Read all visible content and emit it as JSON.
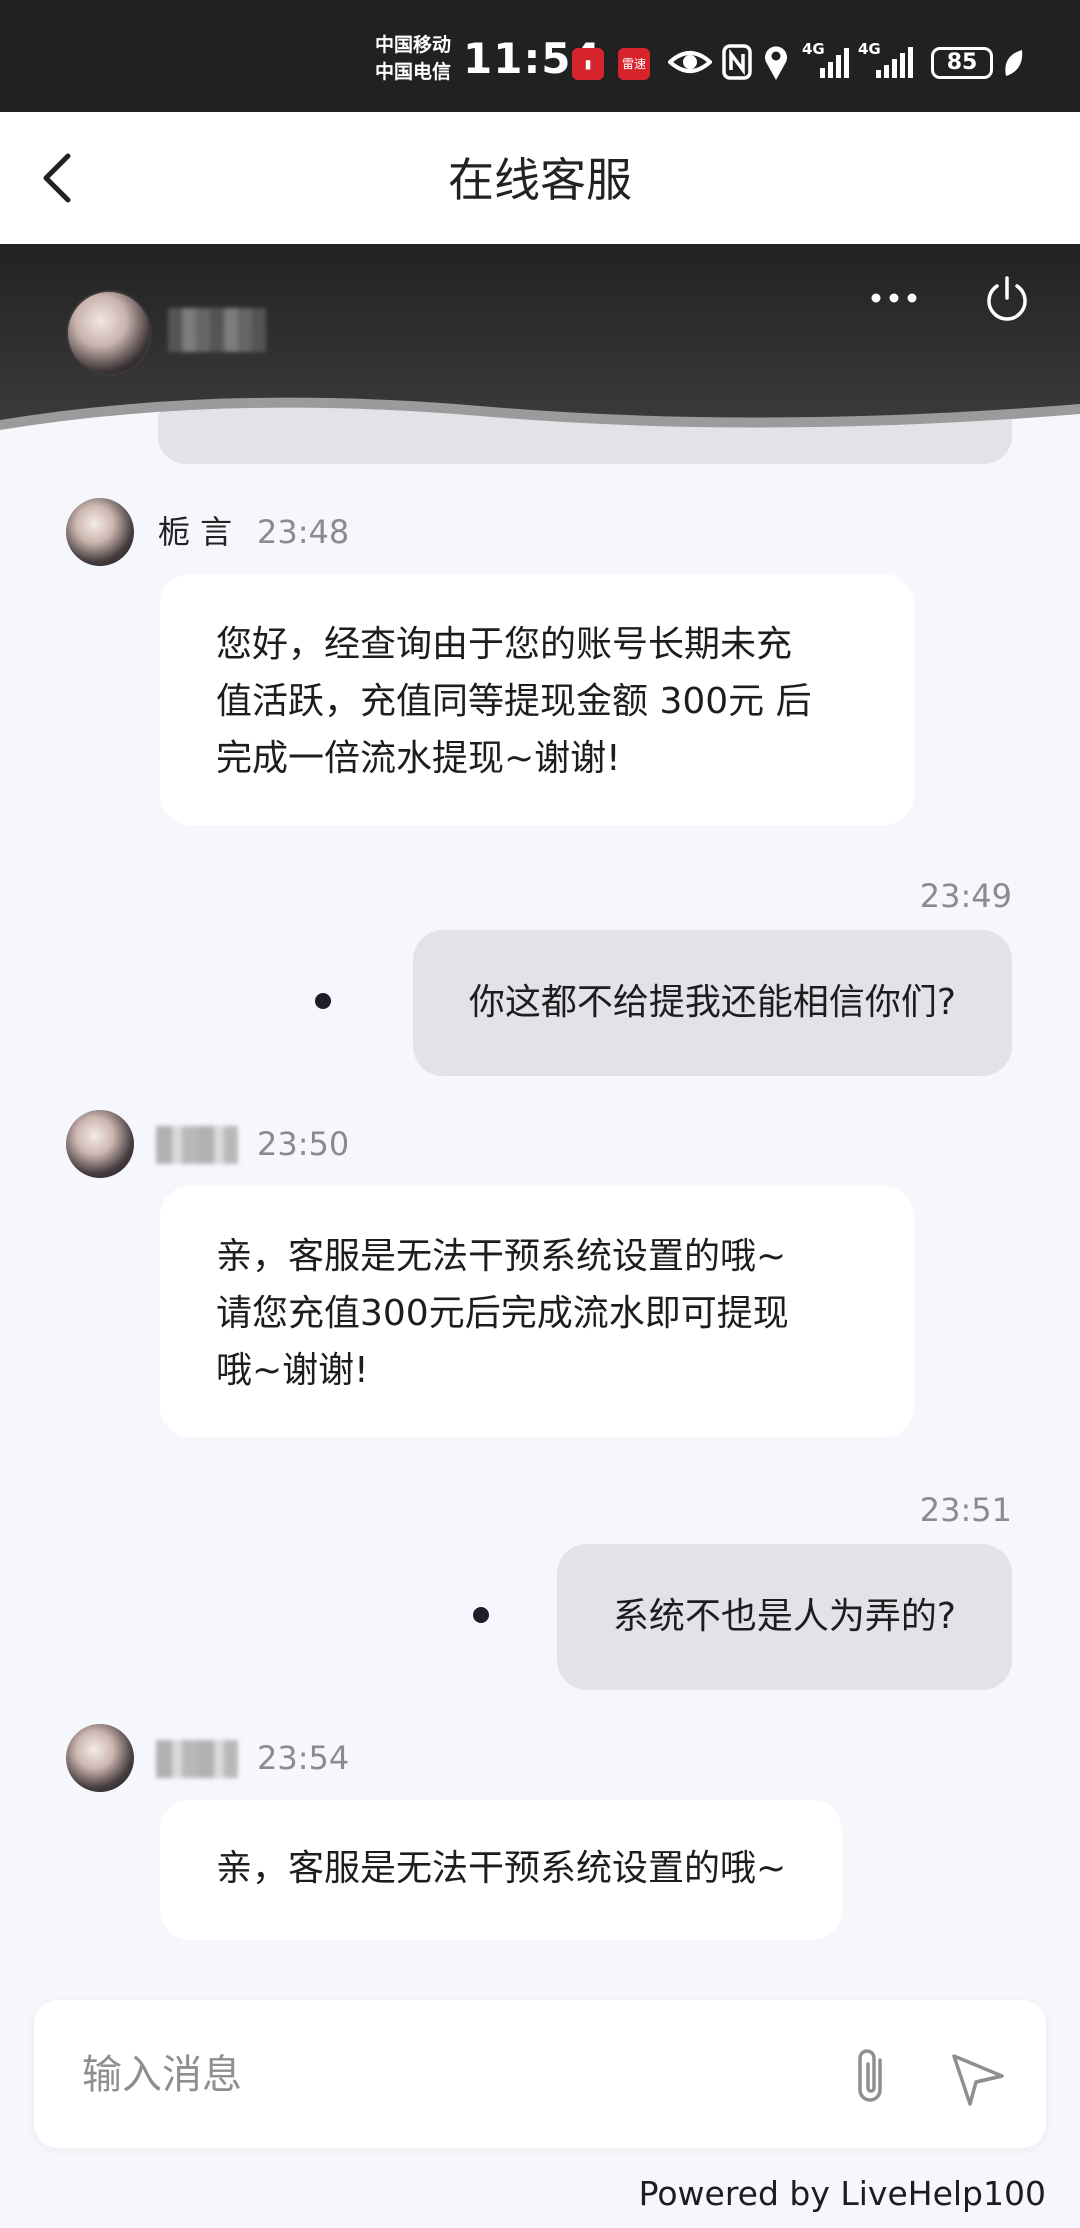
{
  "status_bar": {
    "carrier_1": "中国移动",
    "carrier_2": "中国电信",
    "time": "11:54",
    "app_badge": "雷速",
    "network_1": "4G",
    "network_2": "4G",
    "battery": "85"
  },
  "nav": {
    "title": "在线客服",
    "back_icon": "chevron-left-icon"
  },
  "header": {
    "more_icon": "more-horizontal-icon",
    "power_icon": "power-icon"
  },
  "messages": [
    {
      "direction": "in",
      "sender": "栀 言",
      "time": "23:48",
      "lines": [
        "您好，经查询由于您的账号长期未充",
        "值活跃，充值同等提现金额 300元 后",
        "完成一倍流水提现~谢谢!"
      ]
    },
    {
      "direction": "out",
      "time": "23:49",
      "text": "你这都不给提我还能相信你们?"
    },
    {
      "direction": "in",
      "sender": "",
      "time": "23:50",
      "lines": [
        "亲，客服是无法干预系统设置的哦~",
        "请您充值300元后完成流水即可提现",
        "哦~谢谢!"
      ]
    },
    {
      "direction": "out",
      "time": "23:51",
      "text": "系统不也是人为弄的?"
    },
    {
      "direction": "in",
      "sender": "",
      "time": "23:54",
      "lines": [
        "亲，客服是无法干预系统设置的哦~"
      ]
    }
  ],
  "input": {
    "placeholder": "输入消息",
    "attach_icon": "paperclip-icon",
    "send_icon": "send-icon"
  },
  "footer": {
    "powered_by": "Powered by LiveHelp100"
  }
}
